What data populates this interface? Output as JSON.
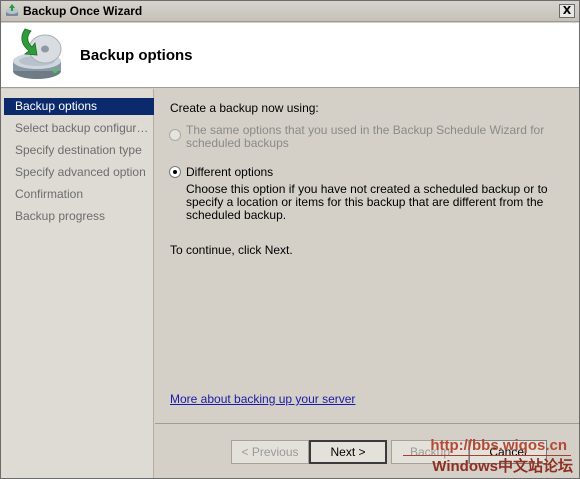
{
  "window": {
    "title": "Backup Once Wizard",
    "close_glyph": "X"
  },
  "header": {
    "title": "Backup options",
    "icon": "backup-disk-icon"
  },
  "sidebar": {
    "items": [
      {
        "label": "Backup options",
        "active": true
      },
      {
        "label": "Select backup configur…",
        "active": false
      },
      {
        "label": "Specify destination type",
        "active": false
      },
      {
        "label": "Specify advanced option",
        "active": false
      },
      {
        "label": "Confirmation",
        "active": false
      },
      {
        "label": "Backup progress",
        "active": false
      }
    ]
  },
  "main": {
    "prompt": "Create a backup now using:",
    "option_same": {
      "label": "The same options that you used in the Backup Schedule Wizard for scheduled backups",
      "enabled": false,
      "selected": false
    },
    "option_different": {
      "label": "Different options",
      "description": "Choose this option if you have not created a scheduled backup or to specify a location or items for this backup that are different from the scheduled backup.",
      "enabled": true,
      "selected": true
    },
    "continue_text": "To continue, click Next.",
    "more_link": "More about backing up your server"
  },
  "footer": {
    "previous": "< Previous",
    "next": "Next >",
    "backup": "Backup",
    "cancel": "Cancel"
  },
  "watermark": {
    "line1": "http://bbs.wiqos.cn",
    "line2": "Windows中文站论坛"
  },
  "colors": {
    "selection": "#0b2a6b",
    "link": "#1a1aa8",
    "dialog_bg": "#d4d0c8",
    "sidebar_bg": "#dedbd5"
  }
}
